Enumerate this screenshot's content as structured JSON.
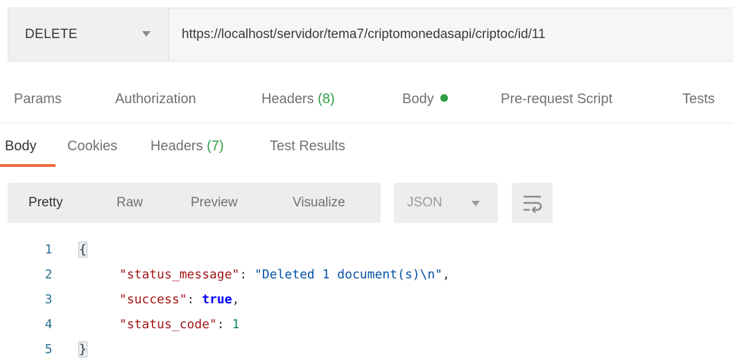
{
  "request": {
    "method": "DELETE",
    "url": "https://localhost/servidor/tema7/criptomonedasapi/criptoc/id/11"
  },
  "request_tabs": [
    {
      "label": "Params"
    },
    {
      "label": "Authorization"
    },
    {
      "label": "Headers",
      "count": "(8)"
    },
    {
      "label": "Body",
      "has_dot": true
    },
    {
      "label": "Pre-request Script"
    },
    {
      "label": "Tests"
    }
  ],
  "response_tabs": [
    {
      "label": "Body",
      "active": true
    },
    {
      "label": "Cookies"
    },
    {
      "label": "Headers",
      "count": "(7)"
    },
    {
      "label": "Test Results"
    }
  ],
  "format_buttons": [
    {
      "label": "Pretty",
      "active": true
    },
    {
      "label": "Raw"
    },
    {
      "label": "Preview"
    },
    {
      "label": "Visualize"
    }
  ],
  "language_select": {
    "value": "JSON"
  },
  "wrap_button": {
    "icon": "wrap-lines-icon"
  },
  "code": {
    "line_numbers": [
      "1",
      "2",
      "3",
      "4",
      "5"
    ],
    "open_brace": "{",
    "close_brace": "}",
    "lines": [
      {
        "key": "\"status_message\"",
        "sep": ": ",
        "value": "\"Deleted 1 document(s)\\n\"",
        "tail": ","
      },
      {
        "key": "\"success\"",
        "sep": ": ",
        "value": "true",
        "tail": ","
      },
      {
        "key": "\"status_code\"",
        "sep": ": ",
        "value": "1",
        "tail": ""
      }
    ]
  },
  "colors": {
    "active_tab_underline": "#f26b3a",
    "count_green": "#2f9d44",
    "json_key": "#a31515",
    "json_string": "#0451a5",
    "json_boolean": "#0000ff",
    "json_number": "#098658"
  }
}
